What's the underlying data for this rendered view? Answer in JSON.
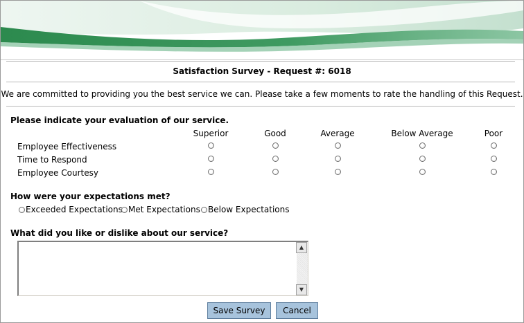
{
  "survey": {
    "title": "Satisfaction Survey - Request #: 6018",
    "intro": "We are committed to providing you the best service we can. Please take a few moments to rate the handling of this Request.",
    "evaluation_heading": "Please indicate your evaluation of our service.",
    "rating_columns": [
      "Superior",
      "Good",
      "Average",
      "Below Average",
      "Poor"
    ],
    "rating_rows": [
      "Employee Effectiveness",
      "Time to Respond",
      "Employee Courtesy"
    ],
    "expectations_heading": "How were your expectations met?",
    "expectations_options": [
      "Exceeded Expectations",
      "Met Expectations",
      "Below Expectations"
    ],
    "comments_heading": "What did you like or dislike about our service?",
    "comments_value": "",
    "save_label": "Save Survey",
    "cancel_label": "Cancel"
  },
  "colors": {
    "banner_green": "#2f8f52",
    "banner_light": "#d6ecdf",
    "button_bg": "#a7c3dc"
  },
  "icons": {
    "scroll_up": "scroll-up-arrow-icon",
    "scroll_down": "scroll-down-arrow-icon"
  }
}
